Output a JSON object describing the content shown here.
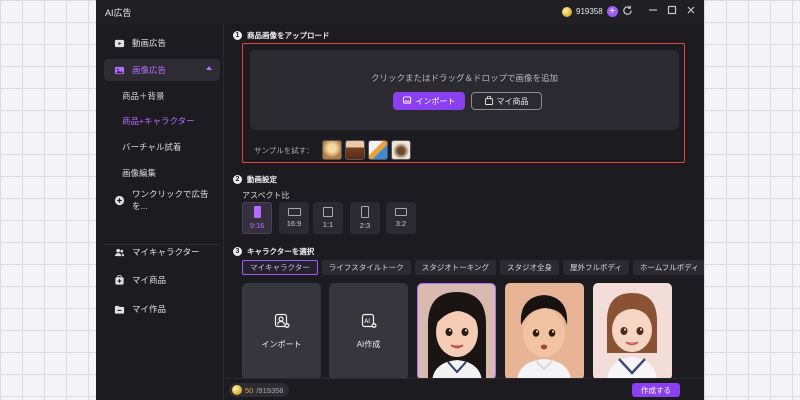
{
  "app": {
    "title": "AI広告"
  },
  "titlebar": {
    "credits": "919358"
  },
  "sidebar": {
    "items": [
      {
        "label": "動画広告",
        "icon": "video-icon"
      },
      {
        "label": "画像広告",
        "icon": "image-icon"
      },
      {
        "label": "ワンクリックで広告を...",
        "icon": "add-circle-icon"
      },
      {
        "label": "マイキャラクター",
        "icon": "people-icon"
      },
      {
        "label": "マイ商品",
        "icon": "product-icon"
      },
      {
        "label": "マイ作品",
        "icon": "folder-icon"
      }
    ],
    "subitems": [
      "商品＋背景",
      "商品+キャラクター",
      "バーチャル試着",
      "画像編集"
    ]
  },
  "section1": {
    "number": "1",
    "title": "商品画像をアップロード",
    "hint": "クリックまたはドラッグ＆ドロップで画像を追加",
    "import_label": "インポート",
    "mine_label": "マイ商品",
    "sample_label": "サンプルを試す："
  },
  "section2": {
    "number": "2",
    "title": "動画設定",
    "aspect_label": "アスペクト比",
    "ratios": [
      "9:16",
      "16:9",
      "1:1",
      "2:3",
      "3:2"
    ],
    "selected": "9:16"
  },
  "section3": {
    "number": "3",
    "title": "キャラクターを選択",
    "tabs": [
      "マイキャラクター",
      "ライフスタイルトーク",
      "スタジオトーキング",
      "スタジオ全身",
      "屋外フルボディ",
      "ホームフルボディ"
    ],
    "import_card": "インポート",
    "ai_card": "AI作成"
  },
  "bottom": {
    "credits_used": "50",
    "credits_total": "/919358",
    "create_label": "作成する"
  },
  "colors": {
    "accent": "#8a3ff0",
    "highlight": "#e5483a"
  }
}
